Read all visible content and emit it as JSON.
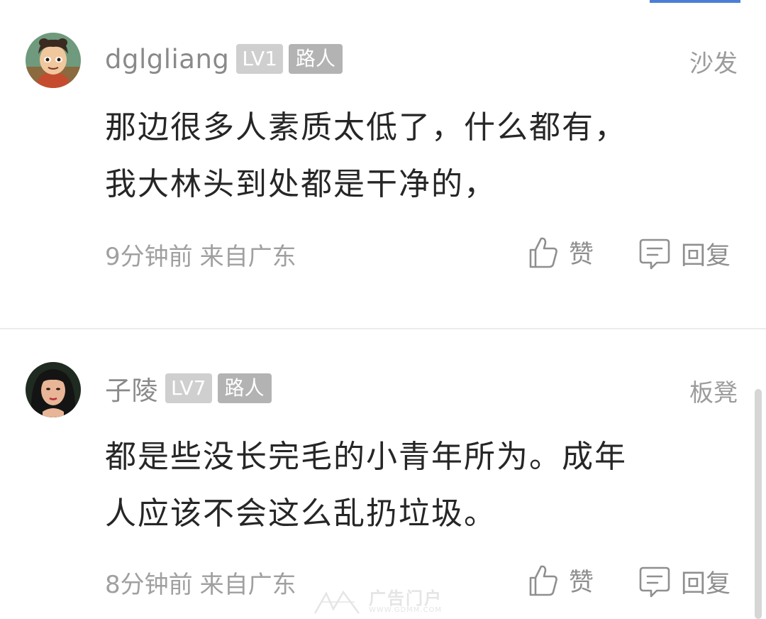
{
  "comments": [
    {
      "username": "dglgliang",
      "level": "LV1",
      "role": "路人",
      "rank_label": "沙发",
      "content_lines": [
        "那边很多人素质太低了，什么都有，",
        "我大林头到处都是干净的，"
      ],
      "time": "9分钟前",
      "location": "来自广东",
      "like_label": "赞",
      "reply_label": "回复"
    },
    {
      "username": "子陵",
      "level": "LV7",
      "role": "路人",
      "rank_label": "板凳",
      "content_lines": [
        "都是些没长完毛的小青年所为。成年",
        "人应该不会这么乱扔垃圾。"
      ],
      "time": "8分钟前",
      "location": "来自广东",
      "like_label": "赞",
      "reply_label": "回复"
    }
  ],
  "watermark": {
    "text": "广告门户",
    "url": "WWW.GDMM.COM"
  },
  "icons": [
    "thumbs-up-icon",
    "comment-bubble-icon"
  ],
  "colors": {
    "username": "#8a8a8a",
    "content": "#262626",
    "meta": "#a0a0a0",
    "badge_level": "#cfcfcf",
    "badge_role": "#b3b3b3",
    "accent": "#4a7fd4"
  }
}
